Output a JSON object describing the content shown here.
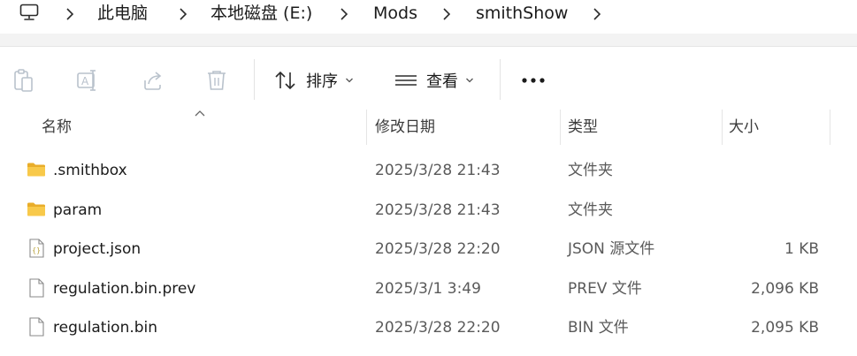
{
  "breadcrumb": {
    "items": [
      "此电脑",
      "本地磁盘 (E:)",
      "Mods",
      "smithShow"
    ]
  },
  "toolbar": {
    "sort_label": "排序",
    "view_label": "查看"
  },
  "columns": {
    "name": "名称",
    "modified": "修改日期",
    "type": "类型",
    "size": "大小"
  },
  "files": [
    {
      "name": ".smithbox",
      "modified": "2025/3/28 21:43",
      "type": "文件夹",
      "size": "",
      "icon": "folder-icon"
    },
    {
      "name": "param",
      "modified": "2025/3/28 21:43",
      "type": "文件夹",
      "size": "",
      "icon": "folder-icon"
    },
    {
      "name": "project.json",
      "modified": "2025/3/28 22:20",
      "type": "JSON 源文件",
      "size": "1 KB",
      "icon": "json-file-icon"
    },
    {
      "name": "regulation.bin.prev",
      "modified": "2025/3/1 3:49",
      "type": "PREV 文件",
      "size": "2,096 KB",
      "icon": "file-icon"
    },
    {
      "name": "regulation.bin",
      "modified": "2025/3/28 22:20",
      "type": "BIN 文件",
      "size": "2,095 KB",
      "icon": "file-icon"
    }
  ],
  "colors": {
    "folder": "#f8c94a",
    "folder_dark": "#e9ad2a",
    "json_accent": "#b9a23c",
    "icon_disabled": "#b9c2cc"
  }
}
